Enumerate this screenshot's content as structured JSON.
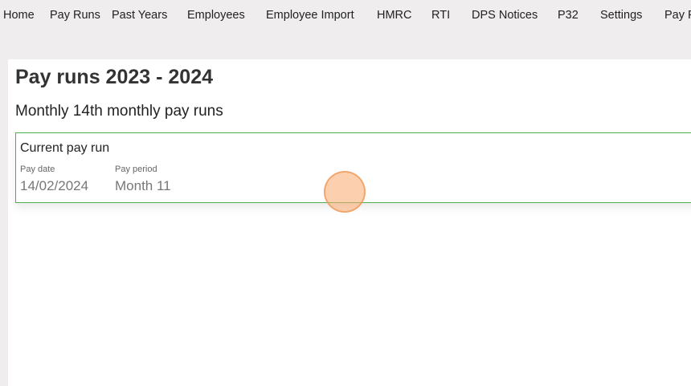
{
  "nav": {
    "items": [
      {
        "label": "Home"
      },
      {
        "label": "Pay Runs"
      },
      {
        "label": "Past Years"
      },
      {
        "label": "Employees"
      },
      {
        "label": "Employee Import"
      },
      {
        "label": "HMRC"
      },
      {
        "label": "RTI"
      },
      {
        "label": "DPS Notices"
      },
      {
        "label": "P32"
      },
      {
        "label": "Settings"
      },
      {
        "label": "Pay F"
      }
    ]
  },
  "page": {
    "title": "Pay runs 2023 - 2024",
    "section_title": "Monthly 14th monthly pay runs"
  },
  "current_pay_run": {
    "title": "Current pay run",
    "pay_date_label": "Pay date",
    "pay_date_value": "14/02/2024",
    "pay_period_label": "Pay period",
    "pay_period_value": "Month 11"
  },
  "colors": {
    "card_border": "#4caf50",
    "click_marker": "#f7a96b"
  }
}
